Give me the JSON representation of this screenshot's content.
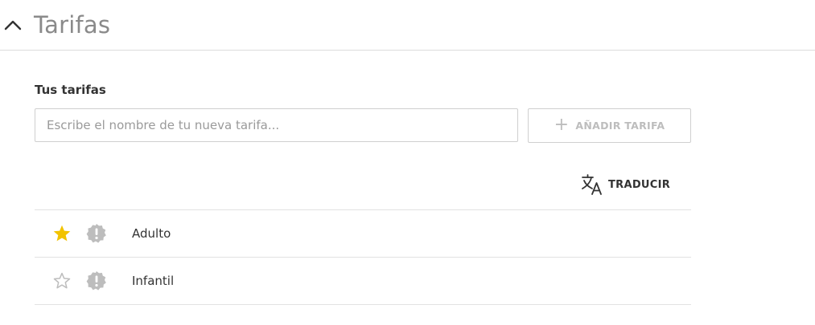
{
  "section": {
    "title": "Tarifas",
    "collapse_icon": "chevron-up-icon"
  },
  "rates": {
    "label": "Tus tarifas",
    "input_placeholder": "Escribe el nombre de tu nueva tarifa...",
    "input_value": "",
    "add_button": {
      "icon": "plus-icon",
      "label": "AÑADIR TARIFA"
    },
    "translate_button": {
      "icon": "translate-icon",
      "label": "TRADUCIR"
    },
    "items": [
      {
        "name": "Adulto",
        "default": true,
        "star_color": "#f2c300",
        "badge_icon": "warning-badge-icon"
      },
      {
        "name": "Infantil",
        "default": false,
        "star_color": "#bdbdbd",
        "badge_icon": "warning-badge-icon"
      }
    ]
  },
  "colors": {
    "title": "#8a8a8a",
    "disabled_text": "#bdbdbd",
    "badge": "#bdbdbd",
    "divider": "#e2e2e2"
  }
}
